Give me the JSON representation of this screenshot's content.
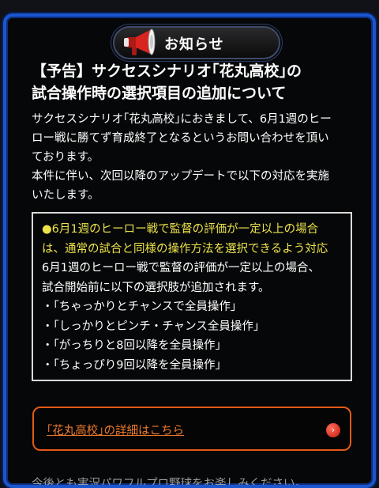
{
  "header": {
    "title": "お知らせ",
    "icon": "megaphone-icon"
  },
  "article": {
    "title_line1": "【予告】サクセスシナリオ｢花丸高校｣の",
    "title_line2": "試合操作時の選択項目の追加について",
    "paragraph1_line1": "サクセスシナリオ｢花丸高校｣におきまして、6月1週のヒー",
    "paragraph1_line2": "ロー戦に勝てず育成終了となるというお問い合わせを頂い",
    "paragraph1_line3": "ております。",
    "paragraph2_line1": "本件に伴い、次回以降のアップデートで以下の対応を実施",
    "paragraph2_line2": "いたします。"
  },
  "notice": {
    "bullet": "●",
    "highlight_line1": "6月1週のヒーロー戦で監督の評価が一定以上の場合",
    "highlight_line2": "は、通常の試合と同様の操作方法を選択できるよう対応",
    "detail_line1": "6月1週のヒーロー戦で監督の評価が一定以上の場合、",
    "detail_line2": "試合開始前に以下の選択肢が追加されます。",
    "options": [
      "・｢ちゃっかりとチャンスで全員操作｣",
      "・｢しっかりとピンチ・チャンス全員操作｣",
      "・｢がっちりと8回以降を全員操作｣",
      "・｢ちょっぴり9回以降を全員操作｣"
    ]
  },
  "link": {
    "label": "｢花丸高校｣の詳細はこちら",
    "arrow": "›"
  },
  "cut_off_text": "今後とも実況パワフルプロ野球をお楽しみください。"
}
